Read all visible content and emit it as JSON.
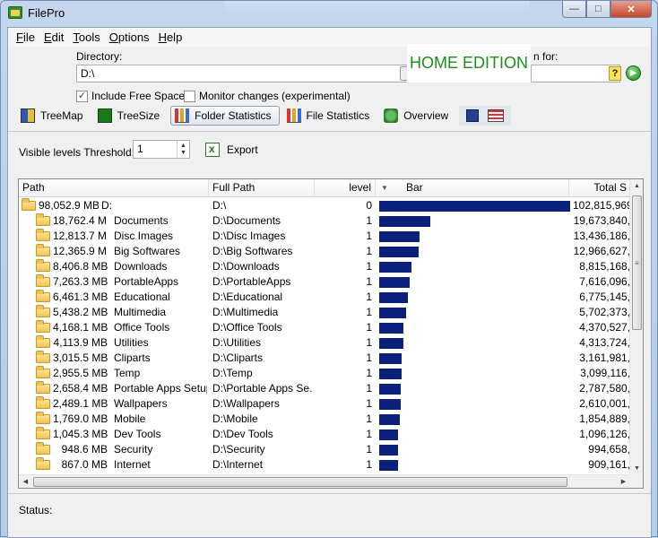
{
  "window": {
    "title": "FilePro"
  },
  "menu": [
    {
      "label": "File",
      "key": "F",
      "rest": "ile"
    },
    {
      "label": "Edit",
      "key": "E",
      "rest": "dit"
    },
    {
      "label": "Tools",
      "key": "T",
      "rest": "ools"
    },
    {
      "label": "Options",
      "key": "O",
      "rest": "ptions"
    },
    {
      "label": "Help",
      "key": "H",
      "rest": "elp"
    }
  ],
  "directory": {
    "label": "Directory:",
    "value": "D:\\"
  },
  "banner": "HOME EDITION",
  "search": {
    "label": "n for:",
    "value": ""
  },
  "options": {
    "include_free_space": {
      "label": "Include Free Space",
      "checked": true
    },
    "monitor_changes": {
      "label": "Monitor changes (experimental)",
      "checked": false
    }
  },
  "toolbar": {
    "treemap": "TreeMap",
    "treesize": "TreeSize",
    "folder_statistics": "Folder Statistics",
    "file_statistics": "File Statistics",
    "overview": "Overview"
  },
  "threshold": {
    "label": "Visible levels Threshold:",
    "value": "1"
  },
  "export_label": "Export",
  "columns": {
    "path": "Path",
    "full_path": "Full Path",
    "level": "level",
    "bar": "Bar",
    "total": "Total S"
  },
  "rows": [
    {
      "size": "98,052.9 MB",
      "name": "D:",
      "full_path": "D:\\",
      "level": "0",
      "bar": 1.0,
      "total": "102,815,969"
    },
    {
      "size": "18,762.4 MB",
      "name": "Documents",
      "full_path": "D:\\Documents",
      "level": "1",
      "bar": 0.2665,
      "total": "19,673,840,"
    },
    {
      "size": "12,813.7 MB",
      "name": "Disc Images",
      "full_path": "D:\\Disc Images",
      "level": "1",
      "bar": 0.2103,
      "total": "13,436,186,"
    },
    {
      "size": "12,365.9 MB",
      "name": "Big Softwares",
      "full_path": "D:\\Big Softwares",
      "level": "1",
      "bar": 0.2061,
      "total": "12,966,627,"
    },
    {
      "size": "8,406.8 MB",
      "name": "Downloads",
      "full_path": "D:\\Downloads",
      "level": "1",
      "bar": 0.1688,
      "total": "8,815,168,"
    },
    {
      "size": "7,263.3 MB",
      "name": "PortableApps",
      "full_path": "D:\\PortableApps",
      "level": "1",
      "bar": 0.158,
      "total": "7,616,096,"
    },
    {
      "size": "6,461.3 MB",
      "name": "Educational",
      "full_path": "D:\\Educational",
      "level": "1",
      "bar": 0.1505,
      "total": "6,775,145,"
    },
    {
      "size": "5,438.2 MB",
      "name": "Multimedia",
      "full_path": "D:\\Multimedia",
      "level": "1",
      "bar": 0.1408,
      "total": "5,702,373,"
    },
    {
      "size": "4,168.1 MB",
      "name": "Office Tools",
      "full_path": "D:\\Office Tools",
      "level": "1",
      "bar": 0.129,
      "total": "4,370,527,"
    },
    {
      "size": "4,113.9 MB",
      "name": "Utilities",
      "full_path": "D:\\Utilities",
      "level": "1",
      "bar": 0.1284,
      "total": "4,313,724,"
    },
    {
      "size": "3,015.5 MB",
      "name": "Cliparts",
      "full_path": "D:\\Cliparts",
      "level": "1",
      "bar": 0.1181,
      "total": "3,161,981,"
    },
    {
      "size": "2,955.5 MB",
      "name": "Temp",
      "full_path": "D:\\Temp",
      "level": "1",
      "bar": 0.1175,
      "total": "3,099,116,"
    },
    {
      "size": "2,658.4 MB",
      "name": "Portable Apps Setup",
      "full_path": "D:\\Portable Apps Se...",
      "level": "1",
      "bar": 0.1147,
      "total": "2,787,580,"
    },
    {
      "size": "2,489.1 MB",
      "name": "Wallpapers",
      "full_path": "D:\\Wallpapers",
      "level": "1",
      "bar": 0.1131,
      "total": "2,610,001,"
    },
    {
      "size": "1,769.0 MB",
      "name": "Mobile",
      "full_path": "D:\\Mobile",
      "level": "1",
      "bar": 0.1064,
      "total": "1,854,889,"
    },
    {
      "size": "1,045.3 MB",
      "name": "Dev Tools",
      "full_path": "D:\\Dev Tools",
      "level": "1",
      "bar": 0.0996,
      "total": "1,096,126,"
    },
    {
      "size": "948.6 MB",
      "name": "Security",
      "full_path": "D:\\Security",
      "level": "1",
      "bar": 0.0987,
      "total": "994,658,"
    },
    {
      "size": "867.0 MB",
      "name": "Internet",
      "full_path": "D:\\Internet",
      "level": "1",
      "bar": 0.0979,
      "total": "909,161,"
    }
  ],
  "status": {
    "label": "Status:"
  },
  "colors": {
    "bar": "#0b1f7d",
    "banner_text": "#1a8f1a"
  }
}
